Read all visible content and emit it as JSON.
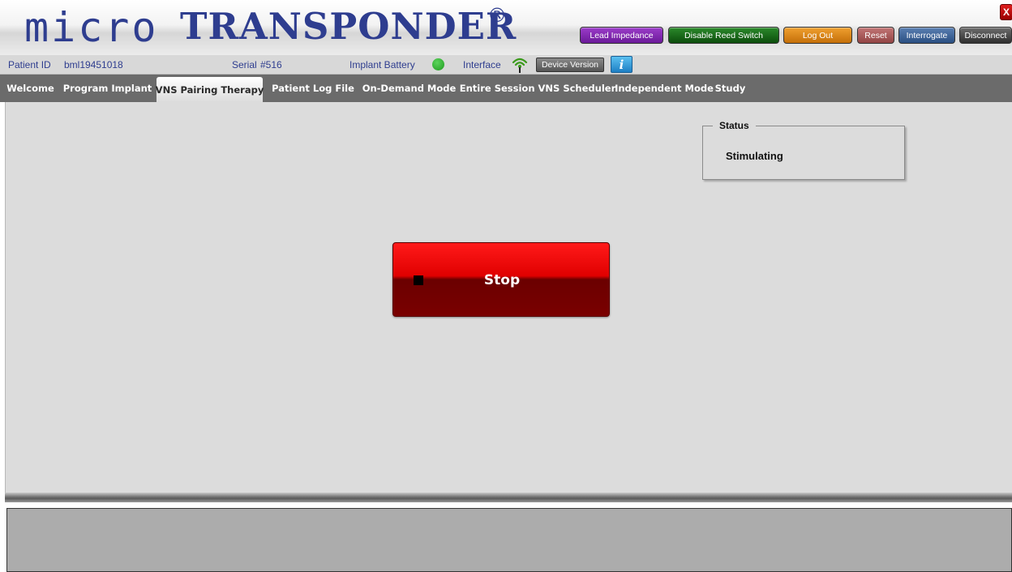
{
  "header": {
    "logo_micro": "micro",
    "logo_transponder": "TRANSPONDER",
    "logo_registered": "®",
    "buttons": {
      "lead_impedance": "Lead Impedance",
      "disable_reed_switch": "Disable Reed Switch",
      "log_out": "Log Out",
      "reset": "Reset",
      "interrogate": "Interrogate",
      "disconnect": "Disconnect"
    },
    "close_label": "X"
  },
  "infobar": {
    "patient_id_label": "Patient ID",
    "patient_id_value": "bml19451018",
    "serial_label": "Serial",
    "serial_value": "#516",
    "implant_battery_label": "Implant Battery",
    "battery_status_color": "#2aa52a",
    "interface_label": "Interface",
    "interface_icon": "wifi-signal-icon",
    "device_version_label": "Device Version",
    "info_label": "i"
  },
  "tabs": [
    {
      "label": "Welcome",
      "active": false
    },
    {
      "label": "Program Implant",
      "active": false
    },
    {
      "label": "VNS Pairing Therapy",
      "active": true
    },
    {
      "label": "Patient Log File",
      "active": false
    },
    {
      "label": "On-Demand Mode",
      "active": false
    },
    {
      "label": "Entire Session VNS Scheduler",
      "active": false
    },
    {
      "label": "Independent Mode",
      "active": false
    },
    {
      "label": "Study",
      "active": false
    }
  ],
  "main": {
    "status_title": "Status",
    "status_value": "Stimulating",
    "stop_button_label": "Stop",
    "stop_icon": "stop-square-icon"
  },
  "colors": {
    "brand": "#2e3d8f",
    "stop_button": "#e00000"
  }
}
